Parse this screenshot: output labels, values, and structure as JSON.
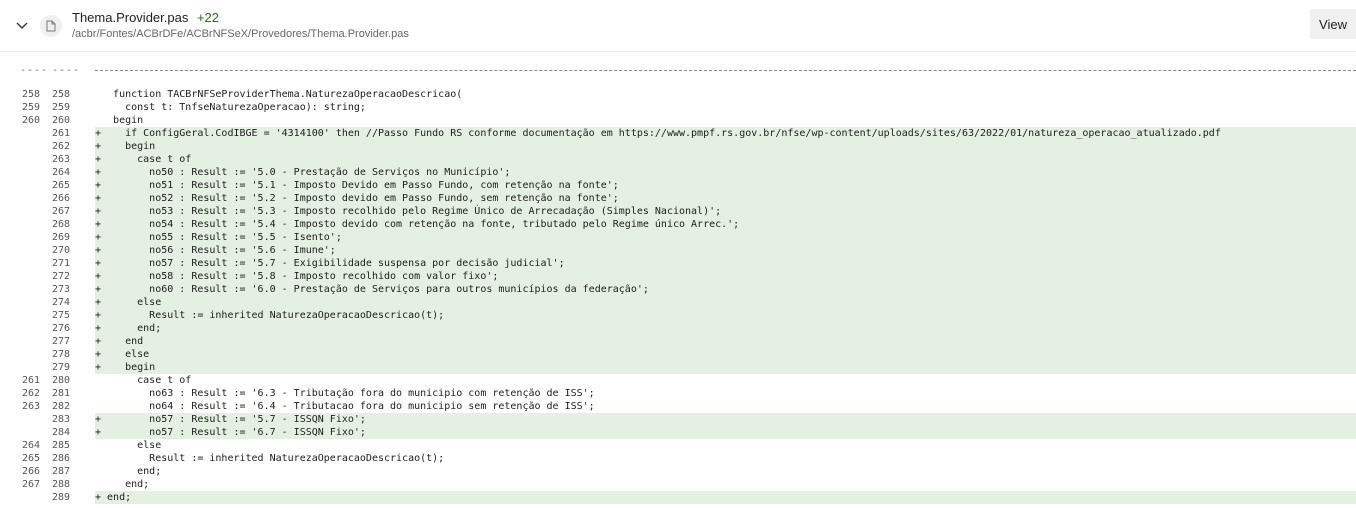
{
  "header": {
    "file_name": "Thema.Provider.pas",
    "added_count": "+22",
    "path": "/acbr/Fontes/ACBrDFe/ACBrNFSeX/Provedores/Thema.Provider.pas",
    "view_label": "View"
  },
  "separator": {
    "old": "----",
    "new": "----"
  },
  "lines": [
    {
      "old": "258",
      "new": "258",
      "type": "ctx",
      "text": "   function TACBrNFSeProviderThema.NaturezaOperacaoDescricao("
    },
    {
      "old": "259",
      "new": "259",
      "type": "ctx",
      "text": "     const t: TnfseNaturezaOperacao): string;"
    },
    {
      "old": "260",
      "new": "260",
      "type": "ctx",
      "text": "   begin"
    },
    {
      "old": "",
      "new": "261",
      "type": "add",
      "text": "+    if ConfigGeral.CodIBGE = '4314100' then //Passo Fundo RS conforme documentação em https://www.pmpf.rs.gov.br/nfse/wp-content/uploads/sites/63/2022/01/natureza_operacao_atualizado.pdf"
    },
    {
      "old": "",
      "new": "262",
      "type": "add",
      "text": "+    begin"
    },
    {
      "old": "",
      "new": "263",
      "type": "add",
      "text": "+      case t of"
    },
    {
      "old": "",
      "new": "264",
      "type": "add",
      "text": "+        no50 : Result := '5.0 - Prestação de Serviços no Município';"
    },
    {
      "old": "",
      "new": "265",
      "type": "add",
      "text": "+        no51 : Result := '5.1 - Imposto Devido em Passo Fundo, com retenção na fonte';"
    },
    {
      "old": "",
      "new": "266",
      "type": "add",
      "text": "+        no52 : Result := '5.2 - Imposto devido em Passo Fundo, sem retenção na fonte';"
    },
    {
      "old": "",
      "new": "267",
      "type": "add",
      "text": "+        no53 : Result := '5.3 - Imposto recolhido pelo Regime Único de Arrecadação (Simples Nacional)';"
    },
    {
      "old": "",
      "new": "268",
      "type": "add",
      "text": "+        no54 : Result := '5.4 - Imposto devido com retenção na fonte, tributado pelo Regime único Arrec.';"
    },
    {
      "old": "",
      "new": "269",
      "type": "add",
      "text": "+        no55 : Result := '5.5 - Isento';"
    },
    {
      "old": "",
      "new": "270",
      "type": "add",
      "text": "+        no56 : Result := '5.6 - Imune';"
    },
    {
      "old": "",
      "new": "271",
      "type": "add",
      "text": "+        no57 : Result := '5.7 - Exigibilidade suspensa por decisão judicial';"
    },
    {
      "old": "",
      "new": "272",
      "type": "add",
      "text": "+        no58 : Result := '5.8 - Imposto recolhido com valor fixo';"
    },
    {
      "old": "",
      "new": "273",
      "type": "add",
      "text": "+        no60 : Result := '6.0 - Prestação de Serviços para outros municípios da federação';"
    },
    {
      "old": "",
      "new": "274",
      "type": "add",
      "text": "+      else"
    },
    {
      "old": "",
      "new": "275",
      "type": "add",
      "text": "+        Result := inherited NaturezaOperacaoDescricao(t);"
    },
    {
      "old": "",
      "new": "276",
      "type": "add",
      "text": "+      end;"
    },
    {
      "old": "",
      "new": "277",
      "type": "add",
      "text": "+    end"
    },
    {
      "old": "",
      "new": "278",
      "type": "add",
      "text": "+    else"
    },
    {
      "old": "",
      "new": "279",
      "type": "add",
      "text": "+    begin"
    },
    {
      "old": "261",
      "new": "280",
      "type": "ctx",
      "text": "       case t of"
    },
    {
      "old": "262",
      "new": "281",
      "type": "ctx",
      "text": "         no63 : Result := '6.3 - Tributação fora do municipio com retenção de ISS';"
    },
    {
      "old": "263",
      "new": "282",
      "type": "ctx",
      "text": "         no64 : Result := '6.4 - Tributacao fora do municipio sem retenção de ISS';"
    },
    {
      "old": "",
      "new": "283",
      "type": "add",
      "text": "+        no57 : Result := '5.7 - ISSQN Fixo';"
    },
    {
      "old": "",
      "new": "284",
      "type": "add",
      "text": "+        no57 : Result := '6.7 - ISSQN Fixo';"
    },
    {
      "old": "264",
      "new": "285",
      "type": "ctx",
      "text": "       else"
    },
    {
      "old": "265",
      "new": "286",
      "type": "ctx",
      "text": "         Result := inherited NaturezaOperacaoDescricao(t);"
    },
    {
      "old": "266",
      "new": "287",
      "type": "ctx",
      "text": "       end;"
    },
    {
      "old": "267",
      "new": "288",
      "type": "ctx",
      "text": "     end;"
    },
    {
      "old": "",
      "new": "289",
      "type": "add",
      "text": "+ end;"
    }
  ]
}
